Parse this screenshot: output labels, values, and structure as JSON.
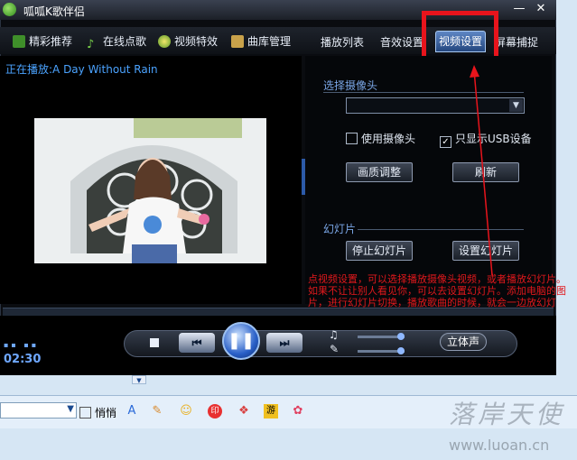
{
  "window": {
    "title": "呱呱K歌伴侣"
  },
  "titlebar": {
    "minimize": "—",
    "close": "✕"
  },
  "nav": [
    {
      "label": "精彩推荐",
      "icon": "recommend-icon"
    },
    {
      "label": "在线点歌",
      "icon": "music-note-icon"
    },
    {
      "label": "视频特效",
      "icon": "video-effect-icon"
    },
    {
      "label": "曲库管理",
      "icon": "library-icon"
    }
  ],
  "tabs": [
    {
      "label": "播放列表"
    },
    {
      "label": "音效设置"
    },
    {
      "label": "视频设置",
      "active": true
    },
    {
      "label": "屏幕捕捉"
    }
  ],
  "now_playing": "正在播放:A Day Without Rain",
  "camera": {
    "section_label": "选择摄像头",
    "use_camera_label": "使用摄像头",
    "use_camera_checked": false,
    "usb_only_label": "只显示USB设备",
    "usb_only_checked": true,
    "quality_button": "画质调整",
    "refresh_button": "刷新"
  },
  "slideshow": {
    "section_label": "幻灯片",
    "stop_button": "停止幻灯片",
    "settings_button": "设置幻灯片"
  },
  "annotation": "点视频设置，可以选择播放摄像头视频，或者播放幻灯片。如果不让让别人看见你，可以去设置幻灯片。添加电脑的图片，进行幻灯片切换，播放歌曲的时候，就会一边放幻灯片，一边唱歌曲。",
  "player": {
    "time": "02:30",
    "stereo_button": "立体声",
    "stop": "■",
    "prev": "⏮",
    "play": "❚❚",
    "next": "⏭",
    "music_glyph": "♫",
    "mic_glyph": "✎"
  },
  "bottom": {
    "checkbox_label": "悄悄"
  },
  "watermark": {
    "text": "落岸天使",
    "url": "www.luoan.cn"
  },
  "colors": {
    "accent": "#e8141c",
    "link_blue": "#4ba3ff"
  }
}
